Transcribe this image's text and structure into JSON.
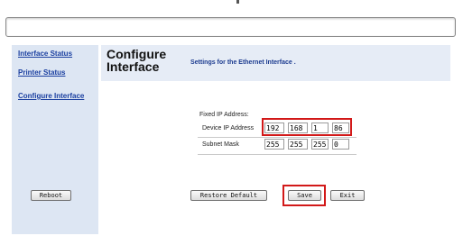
{
  "sidebar": {
    "items": [
      {
        "label": "Interface Status"
      },
      {
        "label": "Printer Status"
      },
      {
        "label": "Configure Interface"
      }
    ],
    "reboot_label": "Reboot"
  },
  "header": {
    "title_line1": "Configure",
    "title_line2": "Interface",
    "description": "Settings for the Ethernet Interface ."
  },
  "form": {
    "section_label": "Fixed IP Address:",
    "device_ip": {
      "label": "Device IP Address",
      "octets": [
        "192",
        "168",
        "1",
        "86"
      ]
    },
    "subnet_mask": {
      "label": "Subnet Mask",
      "octets": [
        "255",
        "255",
        "255",
        "0"
      ]
    }
  },
  "buttons": {
    "restore_default": "Restore Default",
    "save": "Save",
    "exit": "Exit"
  },
  "highlight_color": "#d21919"
}
